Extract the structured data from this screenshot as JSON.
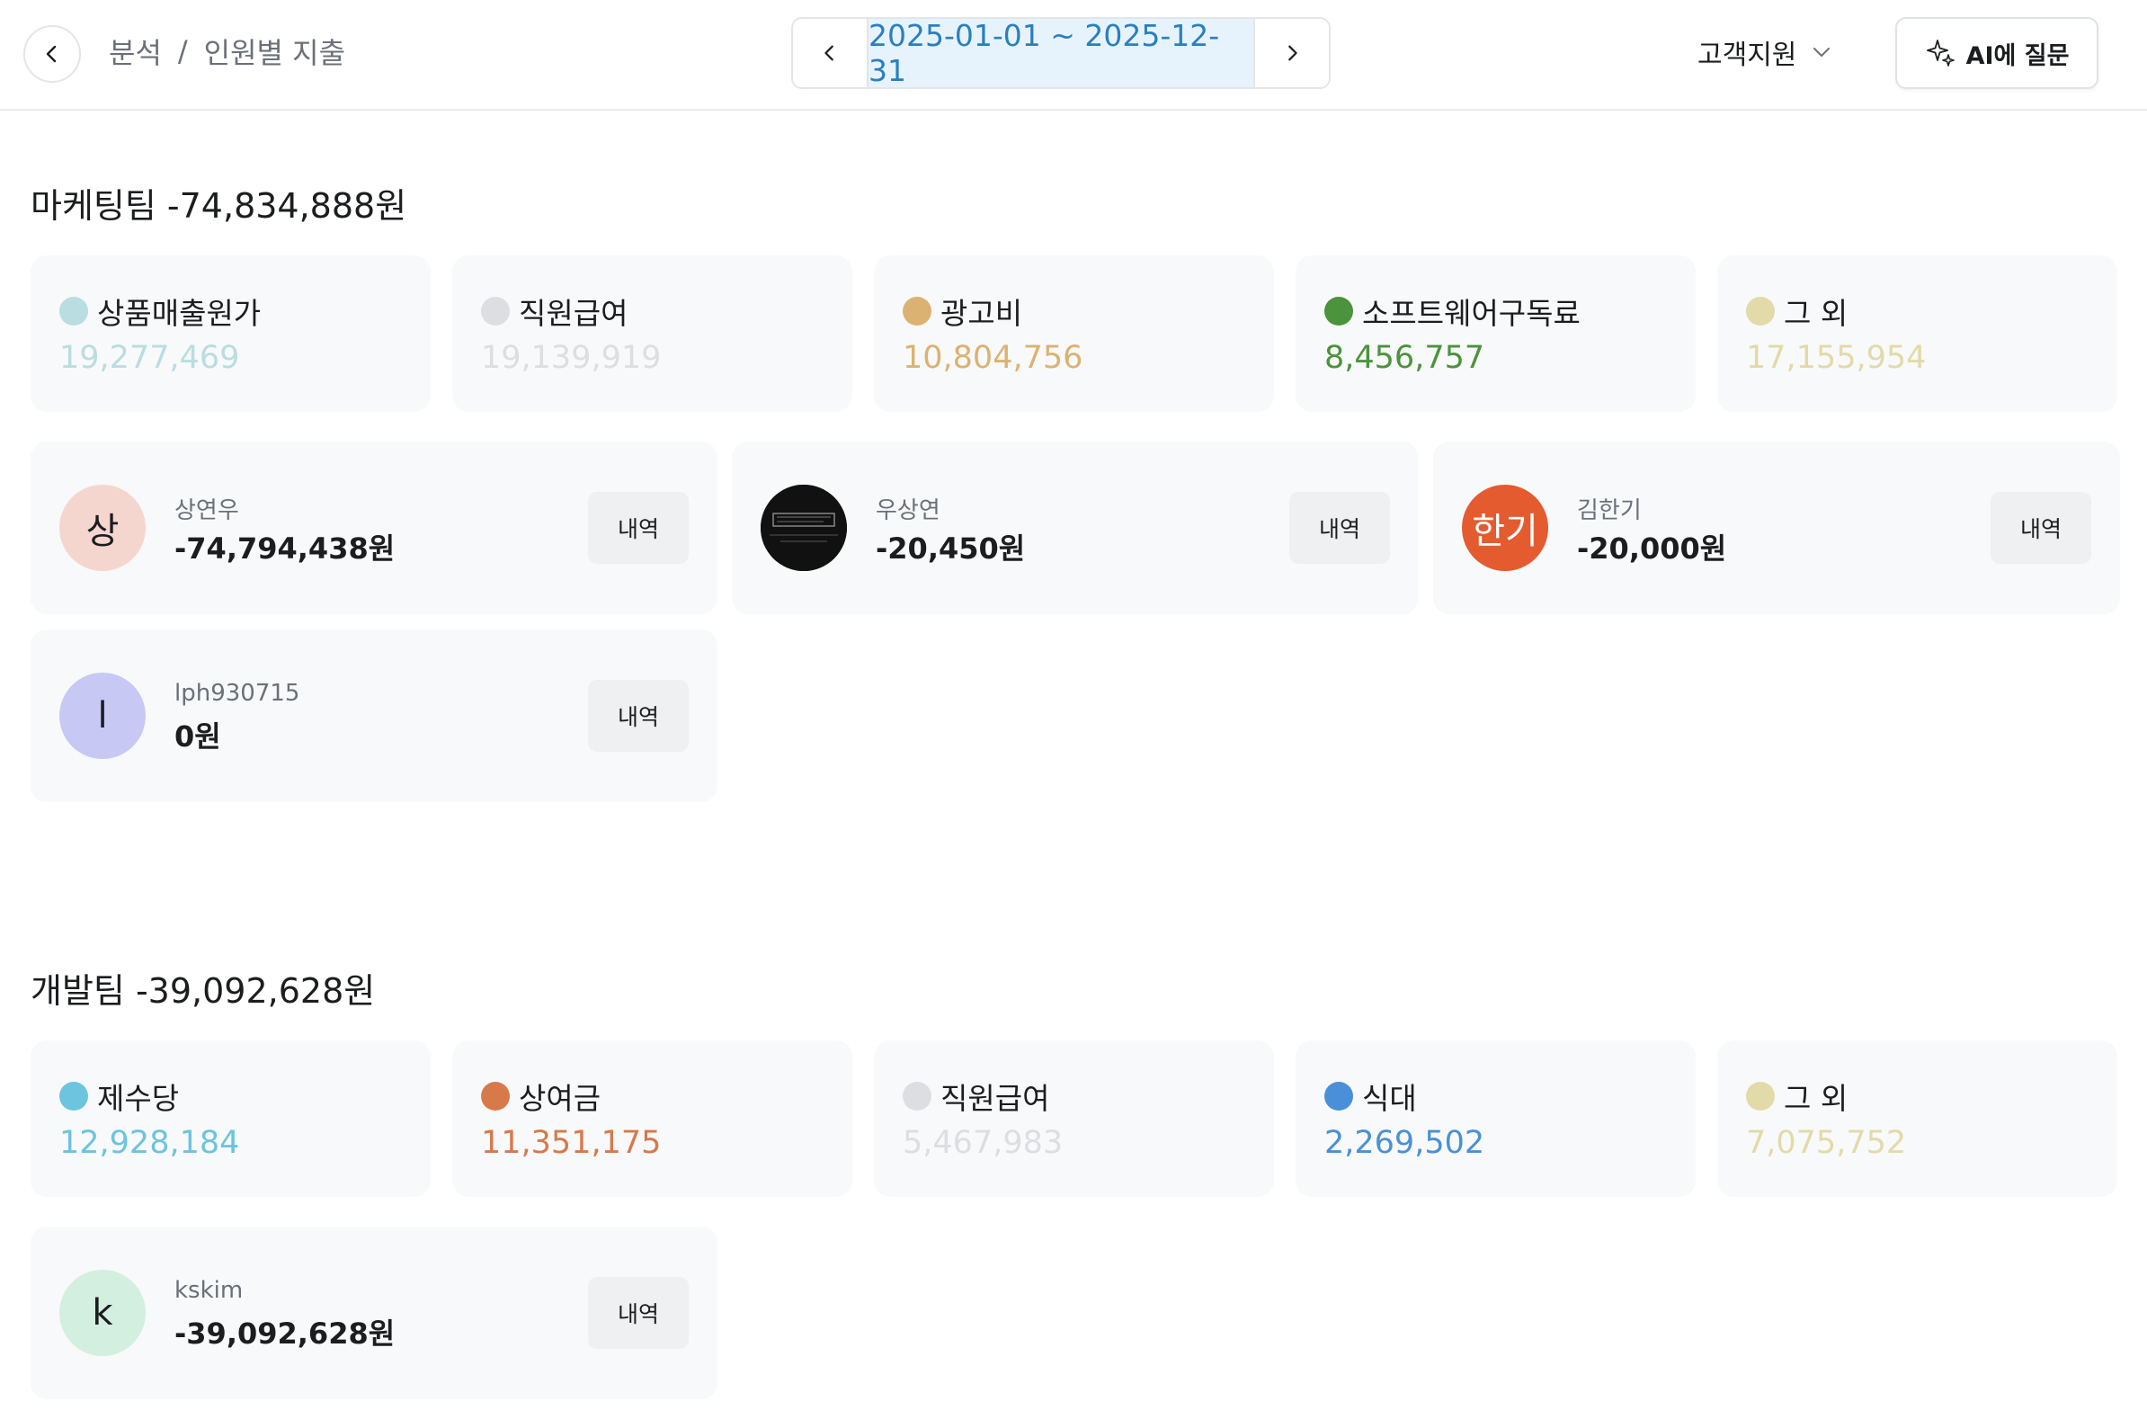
{
  "header": {
    "breadcrumb": [
      "분석",
      "/",
      "인원별 지출"
    ],
    "date_range": "2025-01-01 ~ 2025-12-31",
    "department": "고객지원",
    "ai_button": "AI에 질문"
  },
  "sections": [
    {
      "title": "마케팅팀 -74,834,888원",
      "categories": [
        {
          "name": "상품매출원가",
          "value": "19,277,469",
          "color": "#b9dde0"
        },
        {
          "name": "직원급여",
          "value": "19,139,919",
          "color": "#dcdee1"
        },
        {
          "name": "광고비",
          "value": "10,804,756",
          "color": "#dcb272"
        },
        {
          "name": "소프트웨어구독료",
          "value": "8,456,757",
          "color": "#4b933c"
        },
        {
          "name": "그 외",
          "value": "17,155,954",
          "color": "#e2daa8"
        }
      ],
      "people": [
        {
          "avatar": "상",
          "name": "상연우",
          "amount": "-74,794,438원",
          "button": "내역",
          "avatar_bg": "#f5d6cf",
          "avatar_fg": "#1b1d1f"
        },
        {
          "avatar": "",
          "name": "우상연",
          "amount": "-20,450원",
          "button": "내역",
          "avatar_bg": "#111111",
          "avatar_fg": "#ffffff"
        },
        {
          "avatar": "한기",
          "name": "김한기",
          "amount": "-20,000원",
          "button": "내역",
          "avatar_bg": "#e55b30",
          "avatar_fg": "#ffffff"
        },
        {
          "avatar": "l",
          "name": "lph930715",
          "amount": "0원",
          "button": "내역",
          "avatar_bg": "#c8c8f5",
          "avatar_fg": "#1b1d1f"
        }
      ]
    },
    {
      "title": "개발팀 -39,092,628원",
      "categories": [
        {
          "name": "제수당",
          "value": "12,928,184",
          "color": "#6cc4de"
        },
        {
          "name": "상여금",
          "value": "11,351,175",
          "color": "#d8794a"
        },
        {
          "name": "직원급여",
          "value": "5,467,983",
          "color": "#dcdee1"
        },
        {
          "name": "식대",
          "value": "2,269,502",
          "color": "#4a90d8"
        },
        {
          "name": "그 외",
          "value": "7,075,752",
          "color": "#e2daa8"
        }
      ],
      "people": [
        {
          "avatar": "k",
          "name": "kskim",
          "amount": "-39,092,628원",
          "button": "내역",
          "avatar_bg": "#d3efdf",
          "avatar_fg": "#1b1d1f"
        }
      ]
    }
  ]
}
